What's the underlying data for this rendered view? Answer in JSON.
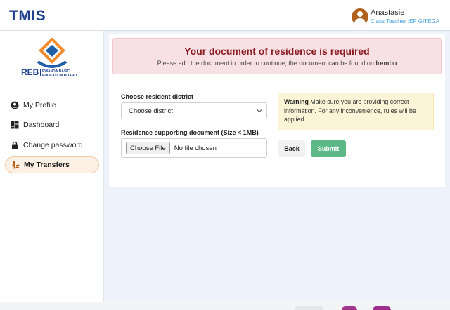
{
  "header": {
    "brand": "TMIS",
    "user_name": "Anastasie",
    "user_role": "Class Teacher :EP GITEGA"
  },
  "sidebar": {
    "logo_abbrev": "REB",
    "logo_line1": "RWANDA BASIC",
    "logo_line2": "EDUCATION BOARD",
    "items": [
      {
        "label": "My Profile",
        "icon": "user-circle-icon"
      },
      {
        "label": "Dashboard",
        "icon": "dashboard-icon"
      },
      {
        "label": "Change password",
        "icon": "lock-icon"
      },
      {
        "label": "My Transfers",
        "icon": "transfer-person-icon",
        "active": true
      }
    ]
  },
  "alert": {
    "title": "Your document of residence is required",
    "subtitle_prefix": "Please add the document in order to continue, the document can be found on ",
    "subtitle_link": "Irembo"
  },
  "form": {
    "district_label": "Choose resident district",
    "district_value": "Choose district",
    "document_label": "Residence supporting document (Size < 1MB)",
    "file_button": "Choose File",
    "file_status": "No file chosen"
  },
  "warning": {
    "title": "Warning",
    "text": " Make sure you are providing correct information. For any inconvenience, rules will be applied"
  },
  "actions": {
    "back_label": "Back",
    "submit_label": "Submit"
  },
  "colors": {
    "brand": "#1f3f8f",
    "alert_title": "#8a1b20",
    "submit": "#5cb886",
    "role": "#4aa3df",
    "active_item": "#fdf1e6"
  }
}
